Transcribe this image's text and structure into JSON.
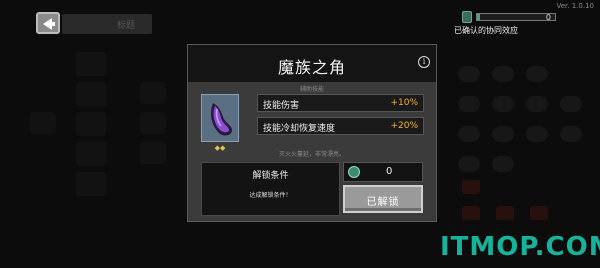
{
  "top_bar": {
    "version": "Ver. 1.0.10",
    "progress_count": "0",
    "progress_fraction": 0.04,
    "effect_label": "已确认的协同效应",
    "tab_label": "标题"
  },
  "dialog": {
    "title": "魔族之角",
    "section_label": "辅助技能",
    "item_icon": "purple-horn-icon",
    "stats": [
      {
        "name": "技能伤害",
        "value": "+10%"
      },
      {
        "name": "技能冷却恢复速度",
        "value": "+20%"
      }
    ],
    "description": "灭火火蔓延，非常漂亮。",
    "unlock": {
      "title": "解锁条件",
      "condition": "达成解锁条件！"
    },
    "cost": {
      "icon": "gem-icon",
      "value": "0"
    },
    "button_label": "已解锁"
  },
  "watermark": "ITMOP.COM",
  "colors": {
    "accent_value": "#f2b13b",
    "watermark": "#16b39a",
    "icon_bg": "#5a6f83"
  }
}
